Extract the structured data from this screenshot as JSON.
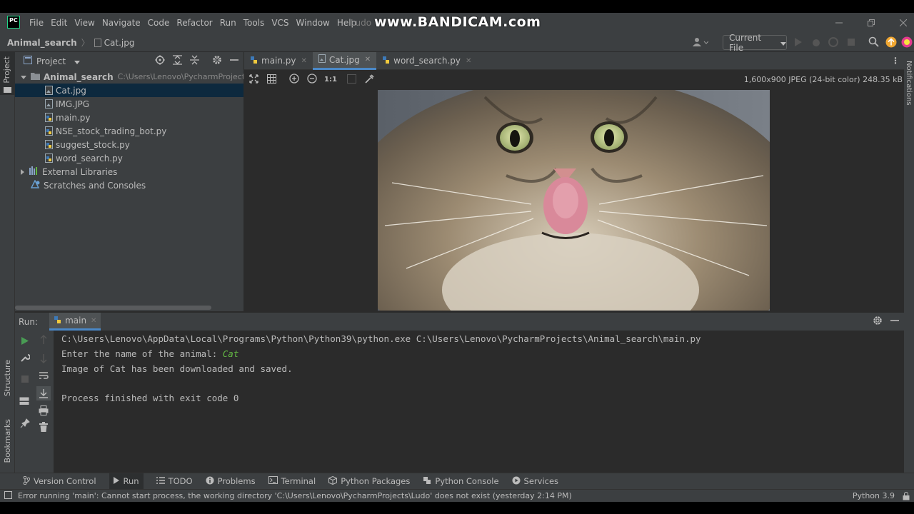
{
  "window": {
    "menu": [
      "File",
      "Edit",
      "View",
      "Navigate",
      "Code",
      "Refactor",
      "Run",
      "Tools",
      "VCS",
      "Window",
      "Help"
    ],
    "project_short": "Ludo",
    "watermark": "www.BANDICAM.com",
    "app_logo_text": "PC"
  },
  "navbar": {
    "project": "Animal_search",
    "file": "Cat.jpg",
    "run_config": "Current File"
  },
  "project_panel": {
    "title": "Project",
    "root": {
      "name": "Animal_search",
      "path": "C:\\Users\\Lenovo\\PycharmProjects\\Anim"
    },
    "files": [
      "Cat.jpg",
      "IMG.JPG",
      "main.py",
      "NSE_stock_trading_bot.py",
      "suggest_stock.py",
      "word_search.py"
    ],
    "selected_file": "Cat.jpg",
    "external_libraries": "External Libraries",
    "scratches": "Scratches and Consoles"
  },
  "left_strip": {
    "project": "Project",
    "structure": "Structure",
    "bookmarks": "Bookmarks"
  },
  "right_strip": {
    "notifications": "Notifications"
  },
  "editor": {
    "tabs": [
      {
        "label": "main.py",
        "active": false
      },
      {
        "label": "Cat.jpg",
        "active": true
      },
      {
        "label": "word_search.py",
        "active": false
      }
    ],
    "zoom_actual": "1:1",
    "image_info": "1,600x900 JPEG (24-bit color) 248.35 kB"
  },
  "run_panel": {
    "label": "Run:",
    "tab": "main",
    "console": {
      "command": "C:\\Users\\Lenovo\\AppData\\Local\\Programs\\Python\\Python39\\python.exe C:\\Users\\Lenovo\\PycharmProjects\\Animal_search\\main.py",
      "prompt": "Enter the name of the animal: ",
      "input": "Cat",
      "result": "Image of Cat has been downloaded and saved.",
      "exit": "Process finished with exit code 0"
    }
  },
  "bottom_tools": [
    "Version Control",
    "Run",
    "TODO",
    "Problems",
    "Terminal",
    "Python Packages",
    "Python Console",
    "Services"
  ],
  "status": {
    "message": "Error running 'main': Cannot start process, the working directory 'C:\\Users\\Lenovo\\PycharmProjects\\Ludo' does not exist (yesterday 2:14 PM)",
    "interpreter": "Python 3.9"
  },
  "colors": {
    "accent": "#4a88c7",
    "selection": "#0d293e",
    "console_input": "#62b543",
    "run_green": "#499c54"
  }
}
